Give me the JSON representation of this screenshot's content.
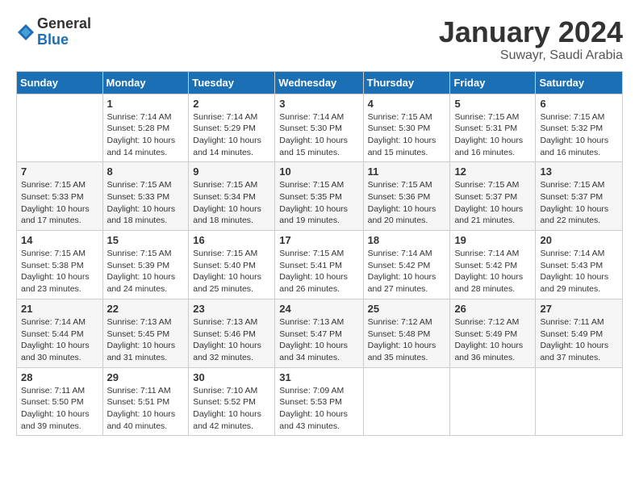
{
  "header": {
    "logo": {
      "general": "General",
      "blue": "Blue"
    },
    "title": "January 2024",
    "subtitle": "Suwayr, Saudi Arabia"
  },
  "calendar": {
    "columns": [
      "Sunday",
      "Monday",
      "Tuesday",
      "Wednesday",
      "Thursday",
      "Friday",
      "Saturday"
    ],
    "weeks": [
      [
        {
          "day": "",
          "info": ""
        },
        {
          "day": "1",
          "info": "Sunrise: 7:14 AM\nSunset: 5:28 PM\nDaylight: 10 hours\nand 14 minutes."
        },
        {
          "day": "2",
          "info": "Sunrise: 7:14 AM\nSunset: 5:29 PM\nDaylight: 10 hours\nand 14 minutes."
        },
        {
          "day": "3",
          "info": "Sunrise: 7:14 AM\nSunset: 5:30 PM\nDaylight: 10 hours\nand 15 minutes."
        },
        {
          "day": "4",
          "info": "Sunrise: 7:15 AM\nSunset: 5:30 PM\nDaylight: 10 hours\nand 15 minutes."
        },
        {
          "day": "5",
          "info": "Sunrise: 7:15 AM\nSunset: 5:31 PM\nDaylight: 10 hours\nand 16 minutes."
        },
        {
          "day": "6",
          "info": "Sunrise: 7:15 AM\nSunset: 5:32 PM\nDaylight: 10 hours\nand 16 minutes."
        }
      ],
      [
        {
          "day": "7",
          "info": "Sunrise: 7:15 AM\nSunset: 5:33 PM\nDaylight: 10 hours\nand 17 minutes."
        },
        {
          "day": "8",
          "info": "Sunrise: 7:15 AM\nSunset: 5:33 PM\nDaylight: 10 hours\nand 18 minutes."
        },
        {
          "day": "9",
          "info": "Sunrise: 7:15 AM\nSunset: 5:34 PM\nDaylight: 10 hours\nand 18 minutes."
        },
        {
          "day": "10",
          "info": "Sunrise: 7:15 AM\nSunset: 5:35 PM\nDaylight: 10 hours\nand 19 minutes."
        },
        {
          "day": "11",
          "info": "Sunrise: 7:15 AM\nSunset: 5:36 PM\nDaylight: 10 hours\nand 20 minutes."
        },
        {
          "day": "12",
          "info": "Sunrise: 7:15 AM\nSunset: 5:37 PM\nDaylight: 10 hours\nand 21 minutes."
        },
        {
          "day": "13",
          "info": "Sunrise: 7:15 AM\nSunset: 5:37 PM\nDaylight: 10 hours\nand 22 minutes."
        }
      ],
      [
        {
          "day": "14",
          "info": "Sunrise: 7:15 AM\nSunset: 5:38 PM\nDaylight: 10 hours\nand 23 minutes."
        },
        {
          "day": "15",
          "info": "Sunrise: 7:15 AM\nSunset: 5:39 PM\nDaylight: 10 hours\nand 24 minutes."
        },
        {
          "day": "16",
          "info": "Sunrise: 7:15 AM\nSunset: 5:40 PM\nDaylight: 10 hours\nand 25 minutes."
        },
        {
          "day": "17",
          "info": "Sunrise: 7:15 AM\nSunset: 5:41 PM\nDaylight: 10 hours\nand 26 minutes."
        },
        {
          "day": "18",
          "info": "Sunrise: 7:14 AM\nSunset: 5:42 PM\nDaylight: 10 hours\nand 27 minutes."
        },
        {
          "day": "19",
          "info": "Sunrise: 7:14 AM\nSunset: 5:42 PM\nDaylight: 10 hours\nand 28 minutes."
        },
        {
          "day": "20",
          "info": "Sunrise: 7:14 AM\nSunset: 5:43 PM\nDaylight: 10 hours\nand 29 minutes."
        }
      ],
      [
        {
          "day": "21",
          "info": "Sunrise: 7:14 AM\nSunset: 5:44 PM\nDaylight: 10 hours\nand 30 minutes."
        },
        {
          "day": "22",
          "info": "Sunrise: 7:13 AM\nSunset: 5:45 PM\nDaylight: 10 hours\nand 31 minutes."
        },
        {
          "day": "23",
          "info": "Sunrise: 7:13 AM\nSunset: 5:46 PM\nDaylight: 10 hours\nand 32 minutes."
        },
        {
          "day": "24",
          "info": "Sunrise: 7:13 AM\nSunset: 5:47 PM\nDaylight: 10 hours\nand 34 minutes."
        },
        {
          "day": "25",
          "info": "Sunrise: 7:12 AM\nSunset: 5:48 PM\nDaylight: 10 hours\nand 35 minutes."
        },
        {
          "day": "26",
          "info": "Sunrise: 7:12 AM\nSunset: 5:49 PM\nDaylight: 10 hours\nand 36 minutes."
        },
        {
          "day": "27",
          "info": "Sunrise: 7:11 AM\nSunset: 5:49 PM\nDaylight: 10 hours\nand 37 minutes."
        }
      ],
      [
        {
          "day": "28",
          "info": "Sunrise: 7:11 AM\nSunset: 5:50 PM\nDaylight: 10 hours\nand 39 minutes."
        },
        {
          "day": "29",
          "info": "Sunrise: 7:11 AM\nSunset: 5:51 PM\nDaylight: 10 hours\nand 40 minutes."
        },
        {
          "day": "30",
          "info": "Sunrise: 7:10 AM\nSunset: 5:52 PM\nDaylight: 10 hours\nand 42 minutes."
        },
        {
          "day": "31",
          "info": "Sunrise: 7:09 AM\nSunset: 5:53 PM\nDaylight: 10 hours\nand 43 minutes."
        },
        {
          "day": "",
          "info": ""
        },
        {
          "day": "",
          "info": ""
        },
        {
          "day": "",
          "info": ""
        }
      ]
    ]
  }
}
